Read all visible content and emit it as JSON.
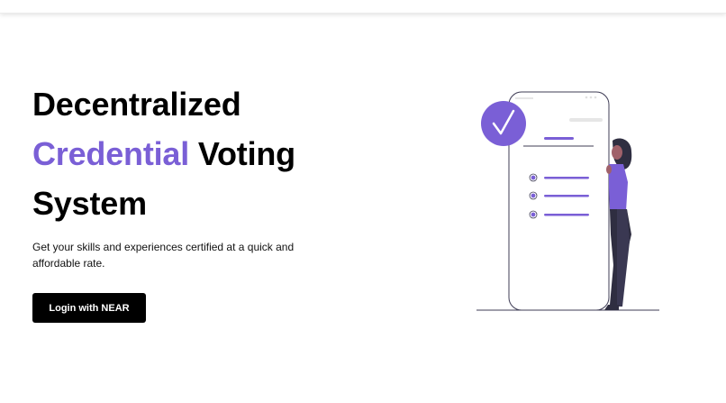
{
  "hero": {
    "title_line1": "Decentralized",
    "title_accent": "Credential",
    "title_voting": "Voting",
    "title_line3": "System",
    "subtitle": "Get your skills and experiences certified at a quick and affordable rate.",
    "login_label": "Login with NEAR"
  },
  "colors": {
    "accent": "#7a5fd6",
    "button_bg": "#000000",
    "button_text": "#ffffff"
  },
  "illustration": {
    "icons": [
      "checkmark-badge-icon",
      "phone-icon",
      "person-icon"
    ]
  }
}
